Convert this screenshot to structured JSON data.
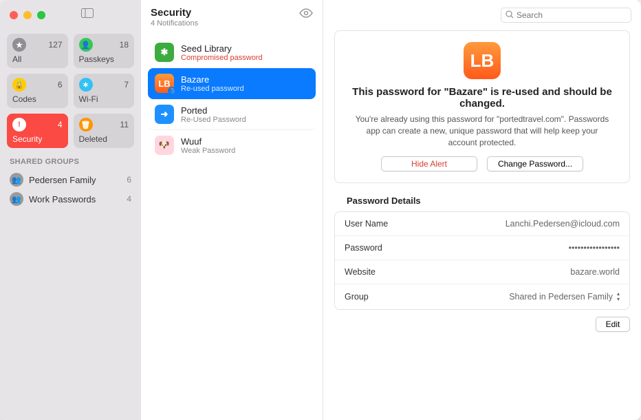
{
  "header": {
    "title": "Security",
    "subtitle": "4 Notifications"
  },
  "search": {
    "placeholder": "Search"
  },
  "categories": [
    {
      "id": "all",
      "label": "All",
      "count": "127",
      "icon": "star",
      "color": "#8e8e93"
    },
    {
      "id": "passkeys",
      "label": "Passkeys",
      "count": "18",
      "icon": "key",
      "color": "#35c759"
    },
    {
      "id": "codes",
      "label": "Codes",
      "count": "6",
      "icon": "lock",
      "color": "#ffcc00"
    },
    {
      "id": "wifi",
      "label": "Wi-Fi",
      "count": "7",
      "icon": "wifi",
      "color": "#33c1f4"
    },
    {
      "id": "security",
      "label": "Security",
      "count": "4",
      "icon": "alert",
      "color": "#fb4943",
      "active": true
    },
    {
      "id": "deleted",
      "label": "Deleted",
      "count": "11",
      "icon": "trash",
      "color": "#ff9500"
    }
  ],
  "shared_groups_header": "SHARED GROUPS",
  "groups": [
    {
      "name": "Pedersen Family",
      "count": "6"
    },
    {
      "name": "Work Passwords",
      "count": "4"
    }
  ],
  "items": [
    {
      "name": "Seed Library",
      "sub": "Compromised password",
      "warn": true,
      "color": "#3eab3e",
      "glyph": "✱"
    },
    {
      "name": "Bazare",
      "sub": "Re-used password",
      "selected": true,
      "shared": true,
      "color": "#ff7a1a",
      "glyph": "LB"
    },
    {
      "name": "Ported",
      "sub": "Re-Used Password",
      "color": "#1e90ff",
      "glyph": "➜"
    },
    {
      "name": "Wuuf",
      "sub": "Weak Password",
      "color": "#ffb6c1",
      "glyph": "🐶"
    }
  ],
  "alert": {
    "icon_color": "#ff7a1a",
    "icon_glyph": "LB",
    "title": "This password for \"Bazare\" is re-used and should be changed.",
    "body": "You're already using this password for \"portedtravel.com\". Passwords app can create a new, unique password that will help keep your account protected.",
    "hide_label": "Hide Alert",
    "change_label": "Change Password..."
  },
  "details": {
    "section_title": "Password Details",
    "rows": {
      "username_k": "User Name",
      "username_v": "Lanchi.Pedersen@icloud.com",
      "password_k": "Password",
      "password_v": "•••••••••••••••••",
      "website_k": "Website",
      "website_v": "bazare.world",
      "group_k": "Group",
      "group_v": "Shared in Pedersen Family"
    },
    "edit_label": "Edit"
  }
}
